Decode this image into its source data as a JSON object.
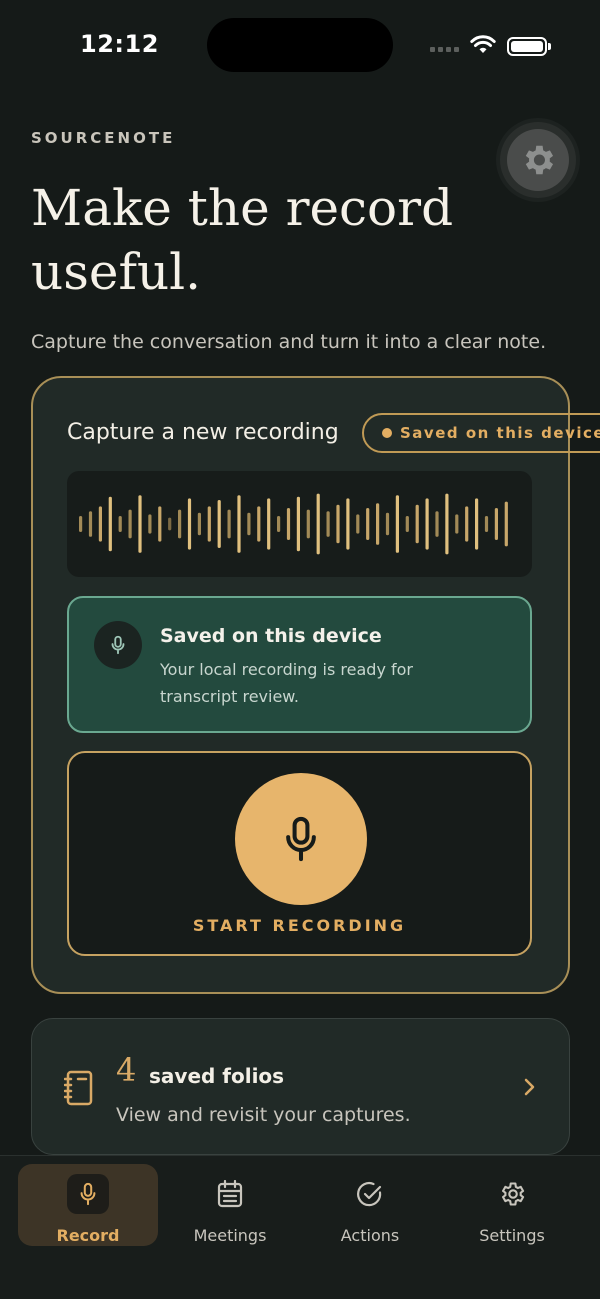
{
  "status_bar": {
    "time": "12:12"
  },
  "brand": "SOURCENOTE",
  "hero": {
    "title": "Make the record useful.",
    "subtitle": "Capture the conversation and turn it into a clear note."
  },
  "capture": {
    "title": "Capture a new recording",
    "saved_badge": "Saved on this device",
    "waveform_levels": [
      0.25,
      0.4,
      0.55,
      0.85,
      0.25,
      0.45,
      0.9,
      0.3,
      0.55,
      0.2,
      0.45,
      0.8,
      0.35,
      0.55,
      0.75,
      0.45,
      0.9,
      0.35,
      0.55,
      0.8,
      0.25,
      0.5,
      0.85,
      0.45,
      0.95,
      0.4,
      0.6,
      0.8,
      0.3,
      0.5,
      0.65,
      0.35,
      0.9,
      0.25,
      0.6,
      0.8,
      0.4,
      0.95,
      0.3,
      0.55,
      0.8,
      0.25,
      0.5,
      0.7
    ],
    "saved_panel": {
      "title": "Saved on this device",
      "text": "Your local recording is ready for transcript review."
    },
    "record_label": "START RECORDING"
  },
  "folios": {
    "count": "4",
    "label": "saved folios",
    "subtitle": "View and revisit your captures."
  },
  "tabs": [
    {
      "label": "Record",
      "icon": "mic-icon",
      "active": true
    },
    {
      "label": "Meetings",
      "icon": "calendar-icon",
      "active": false
    },
    {
      "label": "Actions",
      "icon": "check-circle-icon",
      "active": false
    },
    {
      "label": "Settings",
      "icon": "gear-icon",
      "active": false
    }
  ],
  "colors": {
    "accent": "#e3ae62",
    "background": "#151a18",
    "card": "#212a27",
    "success": "#234a3e"
  }
}
